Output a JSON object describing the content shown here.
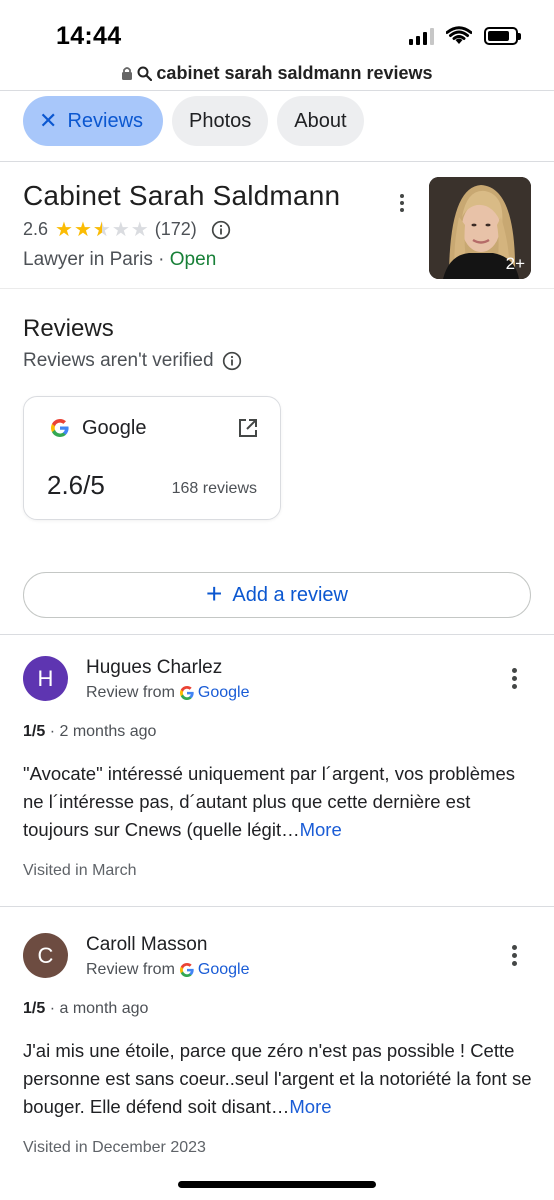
{
  "status_bar": {
    "time": "14:44",
    "battery_level": 0.8,
    "signal_bars": 3
  },
  "url_bar": {
    "query": "cabinet sarah saldmann reviews",
    "icons": [
      "lock-icon",
      "search-icon"
    ]
  },
  "tabs": [
    {
      "label": "Reviews",
      "active": true,
      "icon": "close-icon"
    },
    {
      "label": "Photos",
      "active": false
    },
    {
      "label": "About",
      "active": false
    }
  ],
  "place": {
    "name": "Cabinet Sarah Saldmann",
    "rating": "2.6",
    "rating_value": 2.6,
    "review_count": "(172)",
    "category": "Lawyer in Paris",
    "separator": "·",
    "status": "Open",
    "photo_badge": "2+"
  },
  "reviews_section": {
    "title": "Reviews",
    "subtitle": "Reviews aren't verified",
    "source": {
      "name": "Google",
      "score": "2.6/5",
      "count": "168 reviews"
    },
    "add_review_label": "Add a review"
  },
  "reviews": [
    {
      "initial": "H",
      "avatar_color": "#5e35b1",
      "author": "Hugues Charlez",
      "review_from_label": "Review from",
      "source": "Google",
      "score": "1/5",
      "age": "· 2 months ago",
      "text": "\"Avocate\" intéressé uniquement par l´argent, vos problèmes ne l´intéresse pas, d´autant plus que cette dernière est toujours sur Cnews (quelle légit…",
      "more": "More",
      "visited": "Visited in March"
    },
    {
      "initial": "C",
      "avatar_color": "#6d4c41",
      "author": "Caroll Masson",
      "review_from_label": "Review from",
      "source": "Google",
      "score": "1/5",
      "age": "· a month ago",
      "text": "J'ai mis une étoile, parce que zéro n'est pas possible ! Cette personne est sans coeur..seul l'argent et la notoriété la font se bouger. Elle défend soit disant…",
      "more": "More",
      "visited": "Visited in December 2023"
    }
  ],
  "colors": {
    "accent_blue": "#0b57d0",
    "active_chip": "#a8c7fa",
    "star_yellow": "#fbbc04",
    "open_green": "#188038"
  }
}
